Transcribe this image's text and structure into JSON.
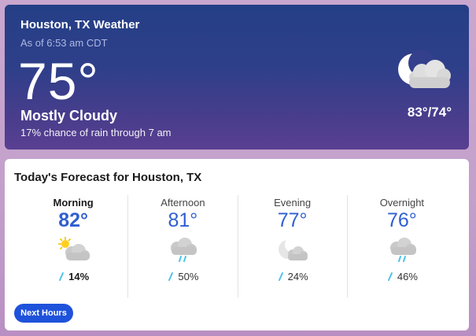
{
  "current": {
    "title": "Houston, TX Weather",
    "as_of": "As of 6:53 am CDT",
    "temperature": "75°",
    "condition": "Mostly Cloudy",
    "rain_note": "17% chance of rain through 7 am",
    "hi_lo": "83°/74°",
    "icon": "moon-cloud-icon"
  },
  "forecast": {
    "title": "Today's Forecast for Houston, TX",
    "periods": [
      {
        "name": "Morning",
        "temp": "82°",
        "precip": "14%",
        "icon": "sun-cloud-icon",
        "selected": true
      },
      {
        "name": "Afternoon",
        "temp": "81°",
        "precip": "50%",
        "icon": "rain-cloud-icon",
        "selected": false
      },
      {
        "name": "Evening",
        "temp": "77°",
        "precip": "24%",
        "icon": "moon-cloud-icon",
        "selected": false
      },
      {
        "name": "Overnight",
        "temp": "76°",
        "precip": "46%",
        "icon": "rain-cloud-icon",
        "selected": false
      }
    ],
    "next_button": "Next Hours"
  },
  "colors": {
    "accent": "#2f5fd0",
    "button": "#1f52db",
    "drop": "#4fc3e8"
  }
}
